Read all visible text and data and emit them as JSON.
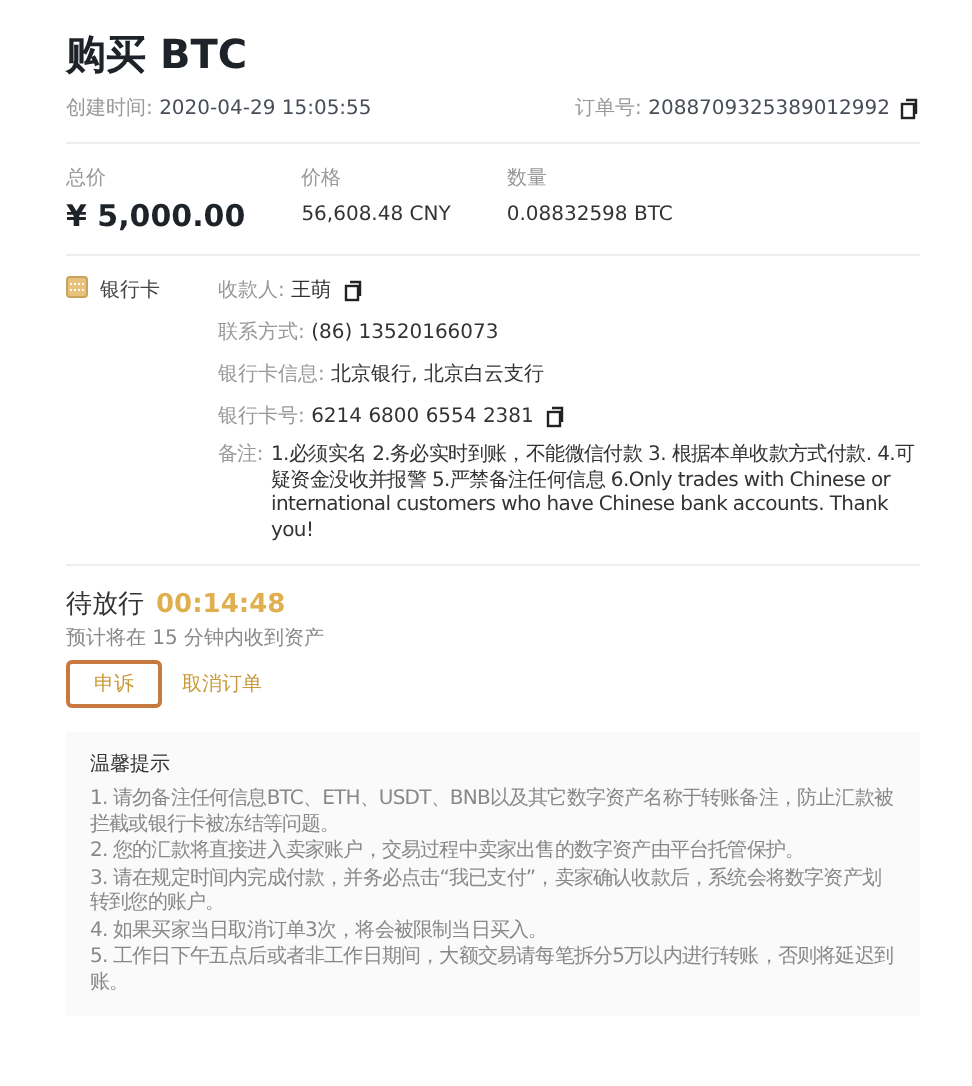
{
  "title": "购买 BTC",
  "created": {
    "label": "创建时间:",
    "value": "2020-04-29 15:05:55"
  },
  "order": {
    "label": "订单号:",
    "value": "2088709325389012992"
  },
  "summary": [
    {
      "label": "总价",
      "value": "¥ 5,000.00",
      "kind": "total"
    },
    {
      "label": "价格",
      "value": "56,608.48 CNY",
      "kind": "plain"
    },
    {
      "label": "数量",
      "value": "0.08832598 BTC",
      "kind": "plain"
    }
  ],
  "payment": {
    "method": "银行卡",
    "fields": [
      {
        "label": "收款人:",
        "value": "王萌",
        "copy": true
      },
      {
        "label": "联系方式:",
        "value": "(86) 13520166073",
        "copy": false
      },
      {
        "label": "银行卡信息:",
        "value": "北京银行, 北京白云支行",
        "copy": false
      },
      {
        "label": "银行卡号:",
        "value": "6214 6800 6554 2381",
        "copy": true
      }
    ],
    "note": {
      "label": "备注:",
      "value": "1.必须实名 2.务必实时到账，不能微信付款 3. 根据本单收款方式付款. 4.可疑资金没收并报警 5.严禁备注任何信息 6.Only trades with Chinese or international customers who have Chinese bank accounts. Thank you!"
    }
  },
  "status": {
    "label": "待放行",
    "timer": "00:14:48",
    "hint": "预计将在 15 分钟内收到资产"
  },
  "buttons": [
    {
      "label": "申诉",
      "kind": "outlined"
    },
    {
      "label": "取消订单",
      "kind": "link"
    }
  ],
  "tips": {
    "title": "温馨提示",
    "items": [
      "1. 请勿备注任何信息BTC、ETH、USDT、BNB以及其它数字资产名称于转账备注，防止汇款被拦截或银行卡被冻结等问题。",
      "2. 您的汇款将直接进入卖家账户，交易过程中卖家出售的数字资产由平台托管保护。",
      "3. 请在规定时间内完成付款，并务必点击“我已支付”，卖家确认收款后，系统会将数字资产划转到您的账户。",
      "4. 如果买家当日取消订单3次，将会被限制当日买入。",
      "5. 工作日下午五点后或者非工作日期间，大额交易请每笔拆分5万以内进行转账，否则将延迟到账。"
    ]
  }
}
